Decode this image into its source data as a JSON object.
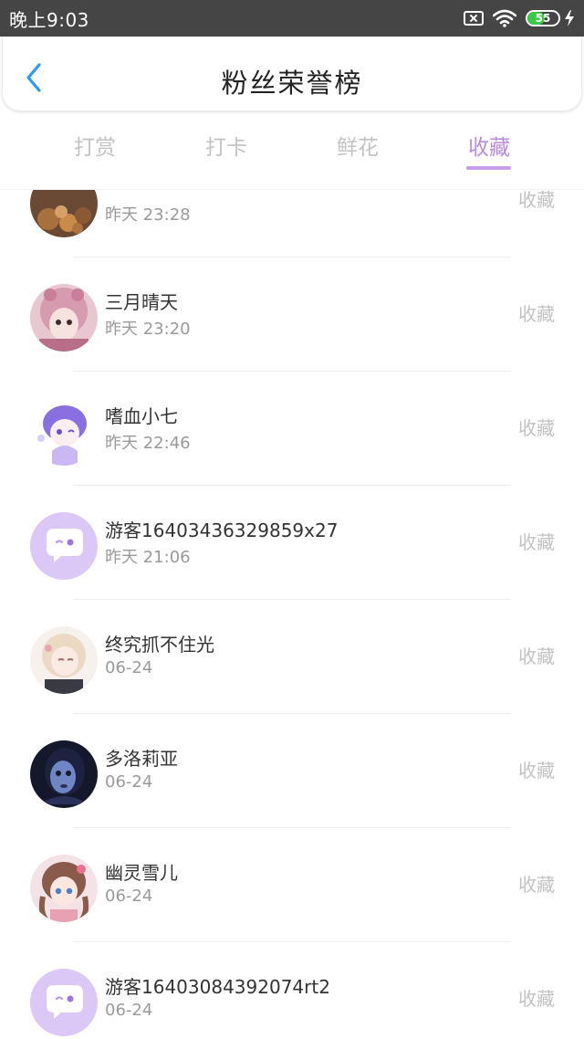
{
  "status_bar": {
    "time": "晚上9:03",
    "battery_level": 55,
    "battery_text": "55",
    "icons": [
      "sim-off-icon",
      "wifi-icon",
      "battery-icon",
      "charging-icon"
    ]
  },
  "header": {
    "back_icon": "chevron-left-icon",
    "title": "粉丝荣誉榜"
  },
  "tabs": [
    {
      "label": "打赏",
      "active": false
    },
    {
      "label": "打卡",
      "active": false
    },
    {
      "label": "鲜花",
      "active": false
    },
    {
      "label": "收藏",
      "active": true
    }
  ],
  "colors": {
    "accent": "#b78be1",
    "underline": "#c89cef",
    "status_bar": "#454545",
    "battery_fill": "#3cc94a"
  },
  "list": [
    {
      "name": "",
      "time": "昨天 23:28",
      "action": "收藏",
      "avatar": "food-photo-avatar"
    },
    {
      "name": "三月晴天",
      "time": "昨天 23:20",
      "action": "收藏",
      "avatar": "pink-hood-girl-avatar"
    },
    {
      "name": "嗜血小七",
      "time": "昨天 22:46",
      "action": "收藏",
      "avatar": "purple-hair-chibi-avatar"
    },
    {
      "name": "游客16403436329859x27",
      "time": "昨天 21:06",
      "action": "收藏",
      "avatar": "guest-chat-bubble-avatar"
    },
    {
      "name": "终究抓不住光",
      "time": "06-24",
      "action": "收藏",
      "avatar": "blonde-girl-avatar"
    },
    {
      "name": "多洛莉亚",
      "time": "06-24",
      "action": "收藏",
      "avatar": "blue-face-avatar"
    },
    {
      "name": "幽灵雪儿",
      "time": "06-24",
      "action": "收藏",
      "avatar": "anime-girl-avatar"
    },
    {
      "name": "游客16403084392074rt2",
      "time": "06-24",
      "action": "收藏",
      "avatar": "guest-chat-bubble-avatar"
    }
  ]
}
